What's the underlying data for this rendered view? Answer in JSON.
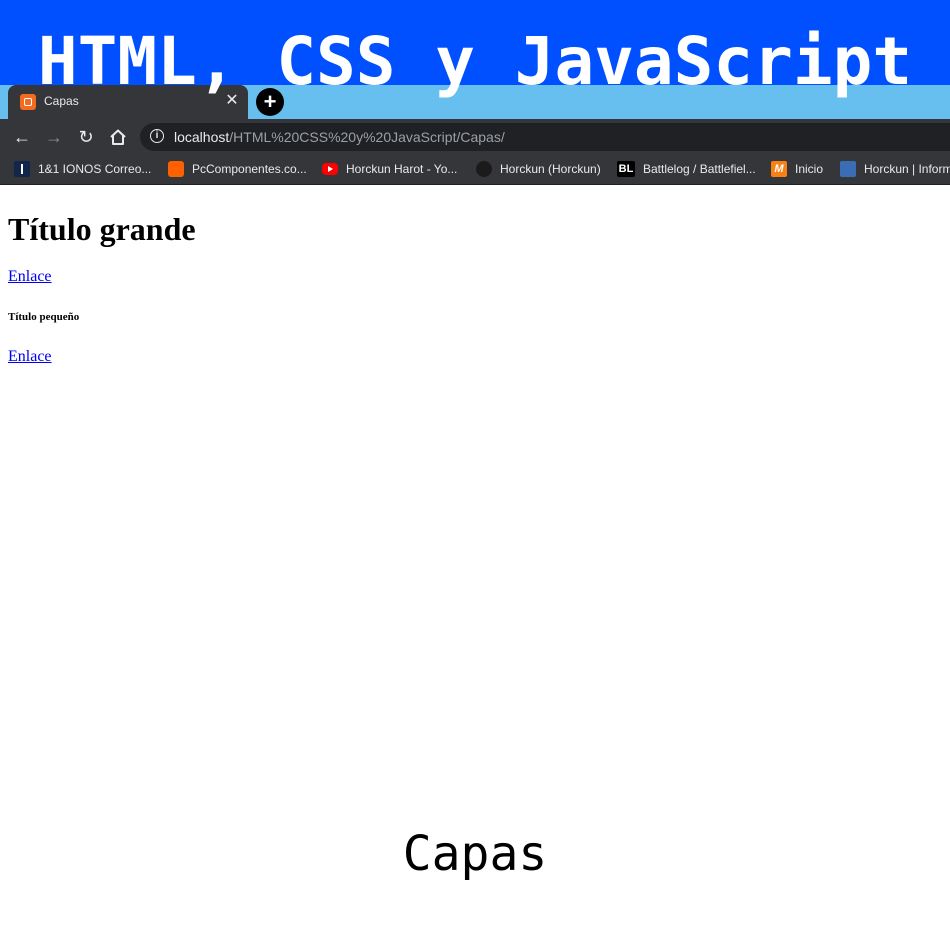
{
  "banner": {
    "title": "HTML, CSS y JavaScript",
    "color": "#0050ff"
  },
  "browser": {
    "tab": {
      "title": "Capas",
      "close_icon": "close-icon"
    },
    "new_tab_icon": "plus-icon",
    "address": {
      "host": "localhost",
      "path": "/HTML%20CSS%20y%20JavaScript/Capas/"
    },
    "bookmarks": [
      {
        "label": "1&1 IONOS Correo...",
        "icon": "ionos-icon"
      },
      {
        "label": "PcComponentes.co...",
        "icon": "pccomponentes-icon"
      },
      {
        "label": "Horckun Harot - Yo...",
        "icon": "youtube-icon"
      },
      {
        "label": "Horckun (Horckun)",
        "icon": "github-icon"
      },
      {
        "label": "Battlelog / Battlefiel...",
        "icon": "battlelog-icon",
        "icon_text": "BL"
      },
      {
        "label": "Inicio",
        "icon": "moodle-icon",
        "icon_text": "M"
      },
      {
        "label": "Horckun | Inform",
        "icon": "horckun-icon"
      }
    ]
  },
  "page": {
    "heading_large": "Título grande",
    "link_1": "Enlace",
    "heading_small": "Título pequeño",
    "link_2": "Enlace"
  },
  "caption": "Capas"
}
